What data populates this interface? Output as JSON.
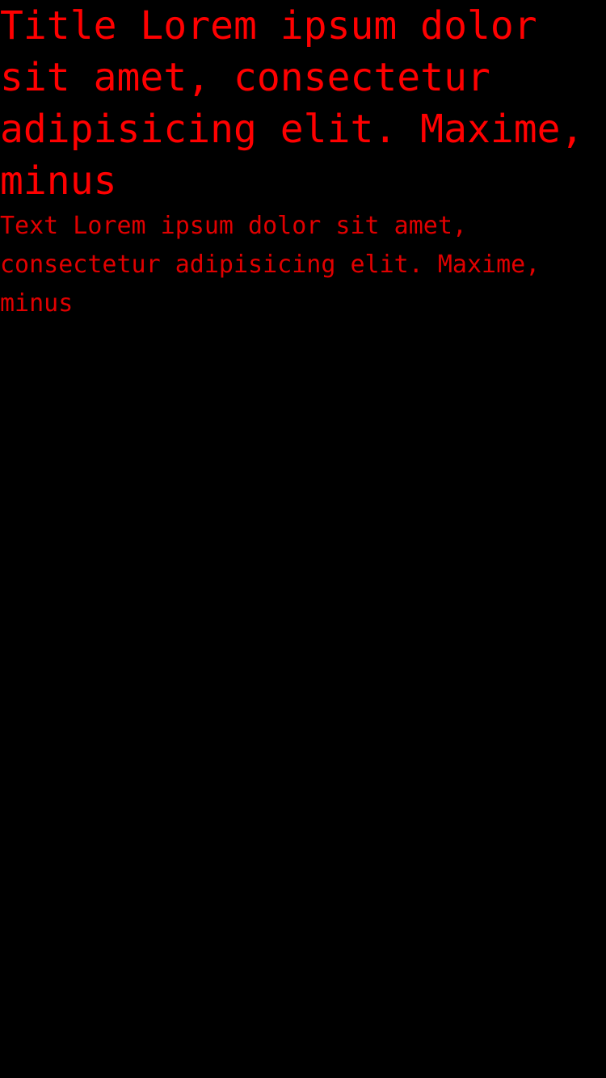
{
  "content": {
    "title": "Title Lorem ipsum dolor sit amet, consectetur adipisicing elit. Maxime, minus",
    "text": "Text Lorem ipsum dolor sit amet, consectetur adipisicing elit. Maxime, minus"
  },
  "colors": {
    "background": "#000000",
    "text": "#ff0000"
  }
}
